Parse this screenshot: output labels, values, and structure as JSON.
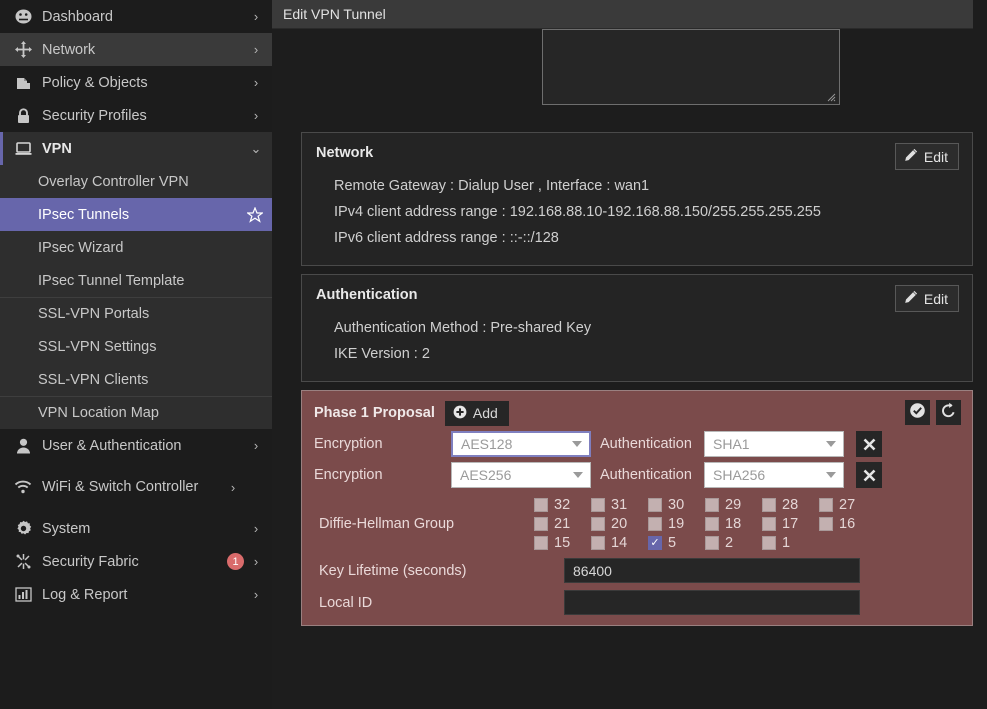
{
  "sidebar": {
    "items": [
      {
        "label": "Dashboard",
        "icon": "gauge-icon",
        "chevron": "›",
        "type": "top",
        "name": "dashboard"
      },
      {
        "label": "Network",
        "icon": "move-arrows-icon",
        "chevron": "›",
        "type": "top",
        "name": "network",
        "hover": true
      },
      {
        "label": "Policy & Objects",
        "icon": "policy-document-icon",
        "chevron": "›",
        "type": "top",
        "name": "policy-objects"
      },
      {
        "label": "Security Profiles",
        "icon": "lock-icon",
        "chevron": "›",
        "type": "top",
        "name": "security-profiles"
      },
      {
        "label": "VPN",
        "icon": "monitor-icon",
        "chevron": "⌄",
        "type": "top",
        "name": "vpn",
        "expanded": true
      }
    ],
    "vpn_children": [
      {
        "label": "Overlay Controller VPN",
        "name": "overlay-controller-vpn"
      },
      {
        "label": "IPsec Tunnels",
        "name": "ipsec-tunnels",
        "active": true,
        "star": true
      },
      {
        "label": "IPsec Wizard",
        "name": "ipsec-wizard"
      },
      {
        "label": "IPsec Tunnel Template",
        "name": "ipsec-tunnel-template"
      },
      {
        "label": "SSL-VPN Portals",
        "name": "ssl-vpn-portals",
        "separator": true
      },
      {
        "label": "SSL-VPN Settings",
        "name": "ssl-vpn-settings"
      },
      {
        "label": "SSL-VPN Clients",
        "name": "ssl-vpn-clients"
      },
      {
        "label": "VPN Location Map",
        "name": "vpn-location-map",
        "separator": true
      }
    ],
    "items_after": [
      {
        "label": "User & Authentication",
        "icon": "user-icon",
        "chevron": "›",
        "name": "user-authentication"
      },
      {
        "label": "WiFi & Switch Controller",
        "icon": "wifi-icon",
        "chevron": "›",
        "name": "wifi-switch-controller",
        "twoline": true
      },
      {
        "label": "System",
        "icon": "gear-icon",
        "chevron": "›",
        "name": "system"
      },
      {
        "label": "Security Fabric",
        "icon": "fabric-icon",
        "chevron": "›",
        "name": "security-fabric",
        "badge": "1"
      },
      {
        "label": "Log & Report",
        "icon": "chart-bar-icon",
        "chevron": "›",
        "name": "log-report"
      }
    ]
  },
  "titlebar": {
    "title": "Edit VPN Tunnel"
  },
  "comments": {
    "value": ""
  },
  "network_panel": {
    "title": "Network",
    "edit_label": "Edit",
    "rows": [
      "Remote Gateway : Dialup User , Interface : wan1",
      "IPv4 client address range : 192.168.88.10-192.168.88.150/255.255.255.255",
      "IPv6 client address range : ::-::/128"
    ]
  },
  "authentication_panel": {
    "title": "Authentication",
    "edit_label": "Edit",
    "rows": [
      "Authentication Method : Pre-shared Key",
      "IKE Version : 2"
    ]
  },
  "phase1_panel": {
    "title": "Phase 1 Proposal",
    "add_label": "Add",
    "ok_icon": "check-circle-icon",
    "revert_icon": "undo-icon",
    "proposals": [
      {
        "encryption_label": "Encryption",
        "encryption_value": "AES128",
        "authentication_label": "Authentication",
        "authentication_value": "SHA1",
        "focused": true
      },
      {
        "encryption_label": "Encryption",
        "encryption_value": "AES256",
        "authentication_label": "Authentication",
        "authentication_value": "SHA256",
        "focused": false
      }
    ],
    "dh_label": "Diffie-Hellman Group",
    "dh_groups": [
      [
        {
          "n": "32",
          "on": false
        },
        {
          "n": "31",
          "on": false
        },
        {
          "n": "30",
          "on": false
        },
        {
          "n": "29",
          "on": false
        },
        {
          "n": "28",
          "on": false
        },
        {
          "n": "27",
          "on": false
        }
      ],
      [
        {
          "n": "21",
          "on": false
        },
        {
          "n": "20",
          "on": false
        },
        {
          "n": "19",
          "on": false
        },
        {
          "n": "18",
          "on": false
        },
        {
          "n": "17",
          "on": false
        },
        {
          "n": "16",
          "on": false
        }
      ],
      [
        {
          "n": "15",
          "on": false
        },
        {
          "n": "14",
          "on": false
        },
        {
          "n": "5",
          "on": true
        },
        {
          "n": "2",
          "on": false
        },
        {
          "n": "1",
          "on": false
        }
      ]
    ],
    "key_lifetime_label": "Key Lifetime (seconds)",
    "key_lifetime_value": "86400",
    "local_id_label": "Local ID",
    "local_id_value": ""
  },
  "colors": {
    "accent_purple": "#6766ab",
    "phase1_bg": "#7b4b4b",
    "badge_red": "#d96b6b",
    "panel_bg": "#242424",
    "sidebar_bg": "#1c1c1c"
  }
}
